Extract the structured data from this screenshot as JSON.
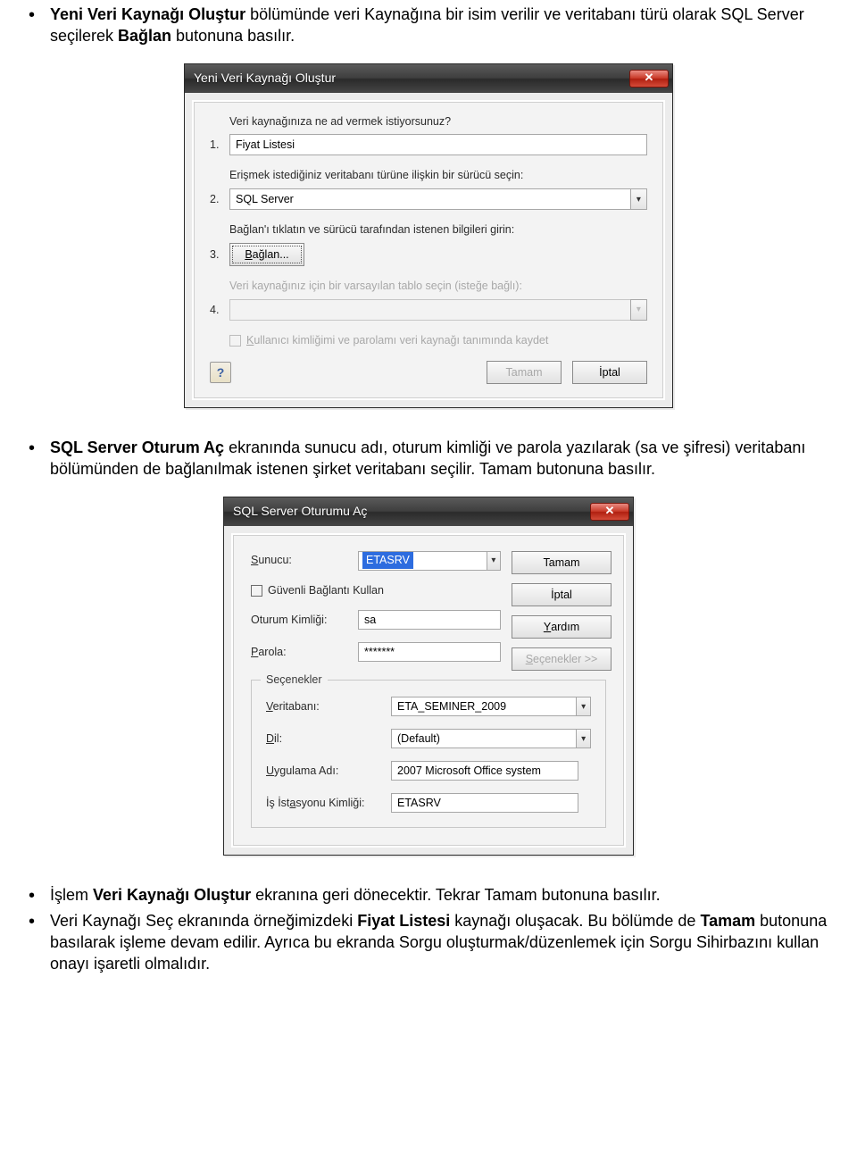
{
  "bullets": {
    "b1_a": "Yeni Veri Kaynağı Oluştur",
    "b1_b": " bölümünde veri Kaynağına bir isim verilir ve veritabanı türü olarak SQL Server seçilerek ",
    "b1_c": "Bağlan",
    "b1_d": " butonuna basılır.",
    "b2_a": "SQL Server Oturum Aç",
    "b2_b": " ekranında sunucu adı, oturum kimliği ve parola yazılarak (sa ve şifresi)  veritabanı bölümünden de bağlanılmak istenen şirket veritabanı seçilir. Tamam butonuna basılır.",
    "b3_a": "İşlem ",
    "b3_b": "Veri Kaynağı Oluştur",
    "b3_c": " ekranına geri dönecektir. Tekrar Tamam butonuna basılır.",
    "b4_a": "Veri Kaynağı Seç ekranında örneğimizdeki ",
    "b4_b": "Fiyat Listesi",
    "b4_c": " kaynağı oluşacak. Bu bölümde de ",
    "b4_d": "Tamam",
    "b4_e": " butonuna basılarak işleme devam edilir. Ayrıca bu ekranda Sorgu oluşturmak/düzenlemek için Sorgu Sihirbazını kullan onayı işaretli olmalıdır."
  },
  "dialog1": {
    "title": "Yeni Veri Kaynağı Oluştur",
    "q1": "Veri kaynağınıza ne ad vermek istiyorsunuz?",
    "n1": "1.",
    "v1": "Fiyat Listesi",
    "q2": "Erişmek istediğiniz veritabanı türüne ilişkin bir sürücü seçin:",
    "n2": "2.",
    "v2": "SQL Server",
    "q3": "Bağlan'ı tıklatın ve sürücü tarafından istenen bilgileri girin:",
    "n3": "3.",
    "connect": "Bağlan...",
    "q4": "Veri kaynağınız için bir varsayılan tablo seçin (isteğe bağlı):",
    "n4": "4.",
    "chk": "Kullanıcı kimliğimi ve parolamı veri kaynağı tanımında kaydet",
    "ok": "Tamam",
    "cancel": "İptal",
    "help": "?"
  },
  "dialog2": {
    "title": "SQL Server Oturumu Aç",
    "server_l": "Sunucu:",
    "server_v": "ETASRV",
    "secure": "Güvenli Bağlantı Kullan",
    "login_l": "Oturum Kimliği:",
    "login_v": "sa",
    "pass_l": "Parola:",
    "pass_v": "*******",
    "ok": "Tamam",
    "cancel": "İptal",
    "help": "Yardım",
    "options": "Seçenekler >>",
    "legend": "Seçenekler",
    "db_l": "Veritabanı:",
    "db_v": "ETA_SEMINER_2009",
    "lang_l": "Dil:",
    "lang_v": "(Default)",
    "app_l": "Uygulama Adı:",
    "app_v": "2007 Microsoft Office system",
    "ws_l": "İş İstasyonu Kimliği:",
    "ws_v": "ETASRV"
  }
}
